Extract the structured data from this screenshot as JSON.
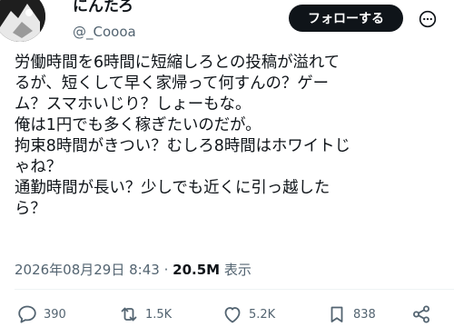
{
  "author": {
    "display_name": "にんたろ",
    "handle": "@_Coooa"
  },
  "follow_label": "フォローする",
  "post_lines": [
    "労働時間を6時間に短縮しろとの投稿が溢れて",
    "るが、短くして早く家帰って何すんの？ゲー",
    "ム？スマホいじり？しょーもな。",
    "俺は1円でも多く稼ぎたいのだが。",
    "拘束8時間がきつい？むしろ8時間はホワイトじ",
    "ゃね？",
    "通勤時間が長い？少しでも近くに引っ越した",
    "ら？"
  ],
  "meta": {
    "date": "2026年08月29日",
    "time": "8:43",
    "separator": "·",
    "views_count": "20.5M",
    "views_label": "表示"
  },
  "actions": {
    "replies": "390",
    "reposts": "1.5K",
    "likes": "5.2K",
    "bookmarks": "838"
  },
  "icons": {
    "reply": "reply-icon",
    "repost": "repost-icon",
    "like": "heart-icon",
    "bookmark": "bookmark-icon",
    "share": "share-icon",
    "more": "more-icon"
  },
  "colors": {
    "text": "#0f1419",
    "secondary": "#536471",
    "button_bg": "#0f1419"
  }
}
